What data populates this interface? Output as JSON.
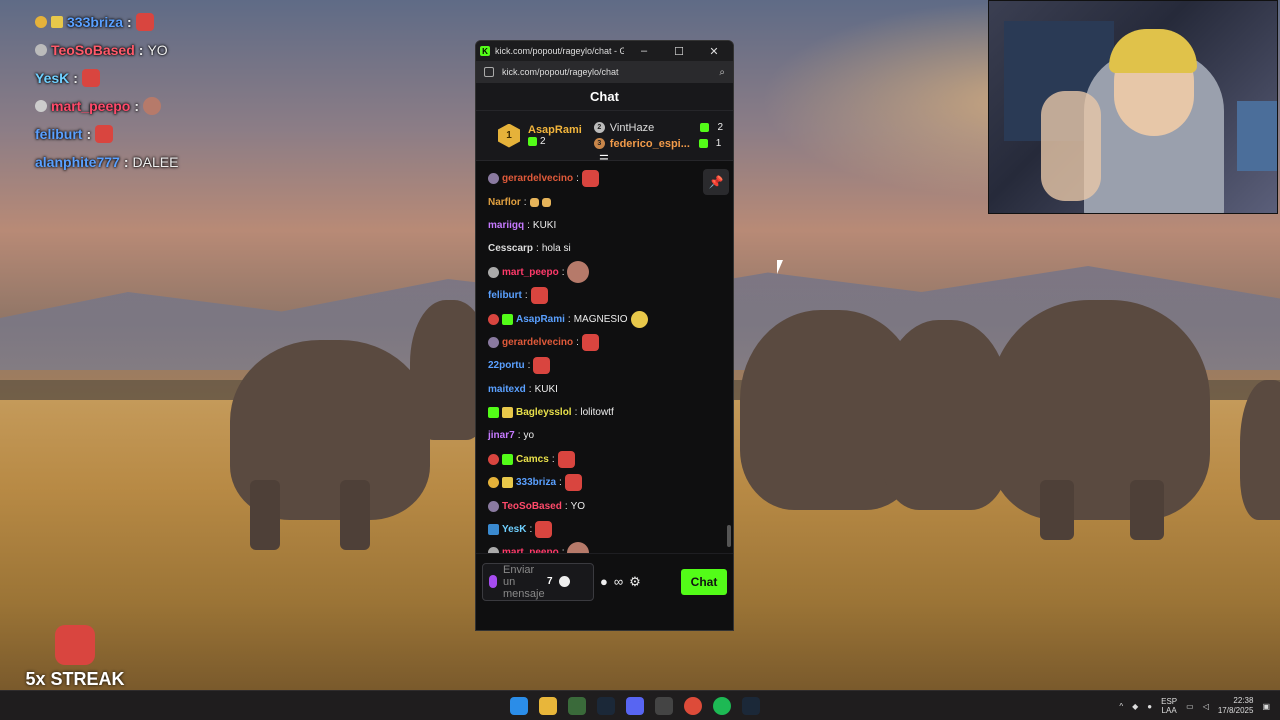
{
  "overlay_chat": [
    {
      "user": "333briza",
      "message": "",
      "color": "#5aa0ff",
      "badge": "#e5b23a"
    },
    {
      "user": "TeoSoBased",
      "message": "YO",
      "color": "#ff5a6a",
      "badge": "#bbbbbb"
    },
    {
      "user": "YesK",
      "message": "",
      "color": "#6fd0ff",
      "badge": ""
    },
    {
      "user": "mart_peepo",
      "message": "",
      "color": "#ff4a6a",
      "badge": "#cccccc"
    },
    {
      "user": "feliburt",
      "message": "",
      "color": "#5aa0ff",
      "badge": ""
    },
    {
      "user": "alanphite777",
      "message": "DALEE",
      "color": "#5aa0ff",
      "badge": ""
    }
  ],
  "streak": {
    "label": "5x STREAK"
  },
  "window": {
    "title": "kick.com/popout/rageylo/chat - Google...",
    "url": "kick.com/popout/rageylo/chat"
  },
  "chat": {
    "header": "Chat",
    "leaderboard": {
      "first": {
        "rank": "1",
        "name": "AsapRami",
        "count": "2"
      },
      "second": {
        "rank": "2",
        "name": "VintHaze",
        "count": "2"
      },
      "third": {
        "rank": "3",
        "name": "federico_espi...",
        "count": "1"
      }
    },
    "messages": [
      {
        "user": "gerardelvecino",
        "text": "",
        "color": "#e05a3a"
      },
      {
        "user": "Narflor",
        "text": "",
        "color": "#e0a040"
      },
      {
        "user": "mariigq",
        "text": "KUKI",
        "color": "#c67aff"
      },
      {
        "user": "Cesscarp",
        "text": "hola si",
        "color": "#dddddd"
      },
      {
        "user": "mart_peepo",
        "text": "",
        "color": "#ff3a6a"
      },
      {
        "user": "feliburt",
        "text": "",
        "color": "#5aa0ff"
      },
      {
        "user": "AsapRami",
        "text": "MAGNESIO",
        "color": "#5aa0ff"
      },
      {
        "user": "gerardelvecino",
        "text": "",
        "color": "#e05a3a"
      },
      {
        "user": "22portu",
        "text": "",
        "color": "#5aa0ff"
      },
      {
        "user": "maitexd",
        "text": "KUKI",
        "color": "#5aa0ff"
      },
      {
        "user": "Bagleysslol",
        "text": "lolitowtf",
        "color": "#e8e04a"
      },
      {
        "user": "jinar7",
        "text": "yo",
        "color": "#c67aff"
      },
      {
        "user": "Camcs",
        "text": "",
        "color": "#e8e04a"
      },
      {
        "user": "333briza",
        "text": "",
        "color": "#5aa0ff"
      },
      {
        "user": "TeoSoBased",
        "text": "YO",
        "color": "#ff4a6a"
      },
      {
        "user": "YesK",
        "text": "",
        "color": "#6fd0ff"
      },
      {
        "user": "mart_peepo",
        "text": "",
        "color": "#ff3a6a"
      }
    ],
    "composer": {
      "placeholder": "Enviar un mensaje",
      "send_label": "Chat",
      "infinity": "∞"
    }
  },
  "tray": {
    "lang_top": "ESP",
    "lang_bottom": "LAA",
    "time": "22:38",
    "date": "17/8/2025"
  }
}
